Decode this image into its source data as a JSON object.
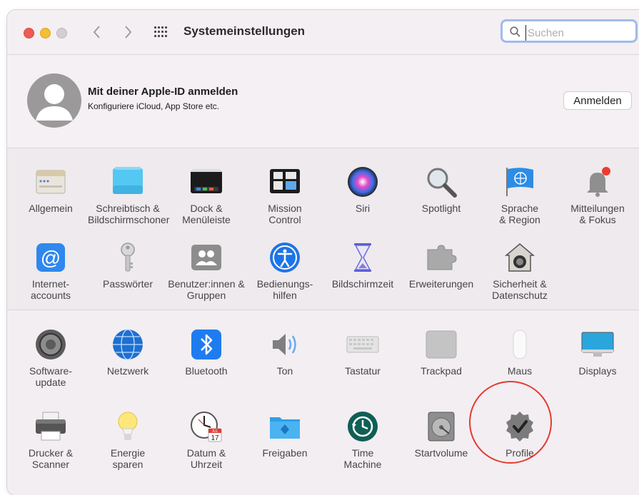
{
  "window": {
    "title": "Systemeinstellungen"
  },
  "search": {
    "placeholder": "Suchen",
    "value": ""
  },
  "apple_id": {
    "title": "Mit deiner Apple-ID anmelden",
    "subtitle": "Konfiguriere iCloud, App Store etc.",
    "button": "Anmelden"
  },
  "section1": {
    "row1": [
      {
        "l1": "Allgemein",
        "l2": ""
      },
      {
        "l1": "Schreibtisch &",
        "l2": "Bildschirmschoner"
      },
      {
        "l1": "Dock &",
        "l2": "Menüleiste"
      },
      {
        "l1": "Mission",
        "l2": "Control"
      },
      {
        "l1": "Siri",
        "l2": ""
      },
      {
        "l1": "Spotlight",
        "l2": ""
      },
      {
        "l1": "Sprache",
        "l2": "& Region"
      },
      {
        "l1": "Mitteilungen",
        "l2": "& Fokus"
      }
    ],
    "row2": [
      {
        "l1": "Internet-",
        "l2": "accounts"
      },
      {
        "l1": "Passwörter",
        "l2": ""
      },
      {
        "l1": "Benutzer:innen &",
        "l2": "Gruppen"
      },
      {
        "l1": "Bedienungs-",
        "l2": "hilfen"
      },
      {
        "l1": "Bildschirmzeit",
        "l2": ""
      },
      {
        "l1": "Erweiterungen",
        "l2": ""
      },
      {
        "l1": "Sicherheit &",
        "l2": "Datenschutz"
      }
    ]
  },
  "section2": {
    "row1": [
      {
        "l1": "Software-",
        "l2": "update"
      },
      {
        "l1": "Netzwerk",
        "l2": ""
      },
      {
        "l1": "Bluetooth",
        "l2": ""
      },
      {
        "l1": "Ton",
        "l2": ""
      },
      {
        "l1": "Tastatur",
        "l2": ""
      },
      {
        "l1": "Trackpad",
        "l2": ""
      },
      {
        "l1": "Maus",
        "l2": ""
      },
      {
        "l1": "Displays",
        "l2": ""
      }
    ],
    "row2": [
      {
        "l1": "Drucker &",
        "l2": "Scanner"
      },
      {
        "l1": "Energie",
        "l2": "sparen"
      },
      {
        "l1": "Datum &",
        "l2": "Uhrzeit"
      },
      {
        "l1": "Freigaben",
        "l2": ""
      },
      {
        "l1": "Time",
        "l2": "Machine"
      },
      {
        "l1": "Startvolume",
        "l2": ""
      },
      {
        "l1": "Profile",
        "l2": ""
      }
    ]
  },
  "calendar_icon": {
    "month": "JUL",
    "day": "17"
  },
  "colors": {
    "accent": "#2f7bf6",
    "highlight_circle": "#e53a2f"
  }
}
